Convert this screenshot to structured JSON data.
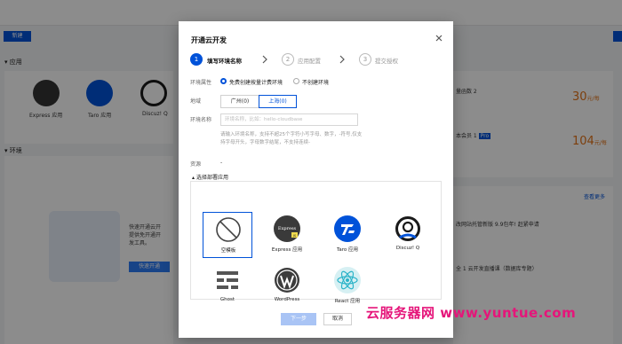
{
  "background": {
    "create_button": "新建",
    "section_apps": "应用",
    "section_env": "环境",
    "apps": [
      "Express 应用",
      "Taro 应用",
      "Discuz! Q"
    ],
    "panel_text": [
      "快速开通云开",
      "提供免开通开",
      "发工具。"
    ],
    "panel_button": "快速开通",
    "right": {
      "items": [
        {
          "label": "量函数 2",
          "num": "30",
          "unit": "元/每"
        },
        {
          "label": "本会员 1",
          "badge": "Pro",
          "num": "104",
          "unit": "元/每"
        }
      ],
      "news": [
        "改网站托管新版 9.9包年! 赶紧申请",
        "全 1 云开发直播课（数据库专题）"
      ],
      "more_link": "查看更多"
    }
  },
  "modal": {
    "title": "开通云开发",
    "steps": [
      {
        "num": "1",
        "label": "填写环境名称",
        "active": true
      },
      {
        "num": "2",
        "label": "应用配置",
        "active": false
      },
      {
        "num": "3",
        "label": "提交授权",
        "active": false
      }
    ],
    "env_type_label": "环境属性",
    "env_type_options": [
      "免费创建按量计费环境",
      "不创建环境"
    ],
    "region_label": "地域",
    "regions": [
      "广州(0)",
      "上海(0)"
    ],
    "env_name_label": "环境名称",
    "env_name_placeholder": "环境名称，比如：hello-cloudbase",
    "env_name_hint": "请输入环境名称，支持不超25个字符小写字母、数字，-符号,仅支持字母开头，字母数字结尾，不支持连续-",
    "resource_label": "资源",
    "resource_value": "-",
    "pick_app_toggle": "选择部署应用",
    "apps": [
      {
        "name": "空模板",
        "icon": "empty-template-icon",
        "selected": true
      },
      {
        "name": "Express 应用",
        "icon": "express-icon",
        "selected": false
      },
      {
        "name": "Taro 应用",
        "icon": "taro-icon",
        "selected": false
      },
      {
        "name": "Discuz! Q",
        "icon": "discuz-icon",
        "selected": false
      },
      {
        "name": "Ghost",
        "icon": "ghost-icon",
        "selected": false
      },
      {
        "name": "WordPress",
        "icon": "wordpress-icon",
        "selected": false
      },
      {
        "name": "React 应用",
        "icon": "react-icon",
        "selected": false
      }
    ],
    "express_badge": "Express",
    "express_js": "JS",
    "next_button": "下一步",
    "cancel_button": "取消"
  },
  "watermark": "云服务器网 www.yuntue.com",
  "colors": {
    "primary": "#0052d9",
    "watermark": "#e5157a",
    "accent_orange": "#e37318"
  }
}
